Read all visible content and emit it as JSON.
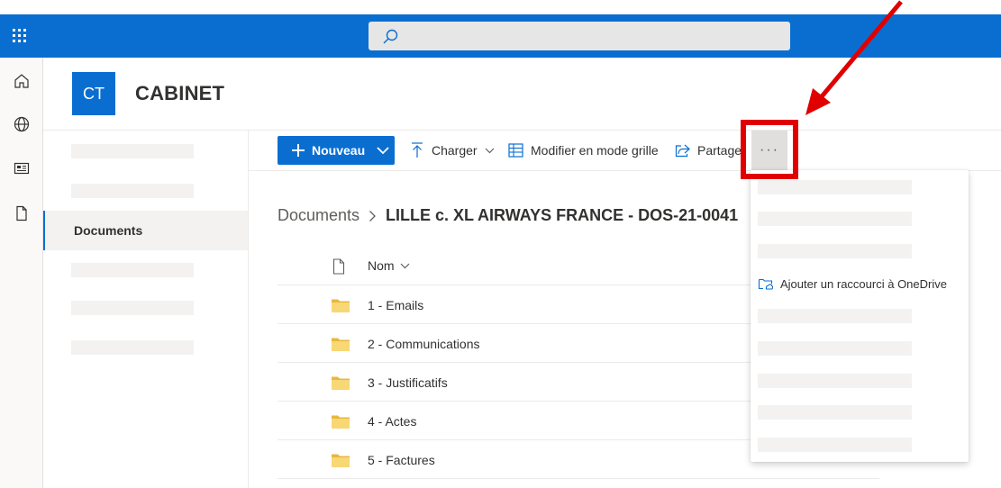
{
  "site": {
    "logo_initials": "CT",
    "title": "CABINET"
  },
  "topbar": {
    "app_launcher_icon": "waffle-icon",
    "search_icon": "search-icon",
    "search_placeholder": ""
  },
  "left_rail": {
    "icons": [
      "home-icon",
      "globe-icon",
      "news-icon",
      "document-icon"
    ]
  },
  "sidenav": {
    "active_item": "Documents"
  },
  "commandbar": {
    "new_label": "Nouveau",
    "upload_label": "Charger",
    "grid_edit_label": "Modifier en mode grille",
    "share_label": "Partager",
    "more_label": "···"
  },
  "breadcrumb": {
    "root": "Documents",
    "separator": ">",
    "current": "LILLE c. XL AIRWAYS FRANCE - DOS-21-0041"
  },
  "list": {
    "name_header": "Nom",
    "rows": [
      {
        "name": "1 - Emails"
      },
      {
        "name": "2 - Communications"
      },
      {
        "name": "3 - Justificatifs"
      },
      {
        "name": "4 - Actes"
      },
      {
        "name": "5 - Factures"
      }
    ]
  },
  "dropdown": {
    "shortcut_label": "Ajouter un raccourci à OneDrive"
  },
  "colors": {
    "brand": "#0a6ed1",
    "highlight": "#e00000",
    "folder": "#f8d775"
  }
}
